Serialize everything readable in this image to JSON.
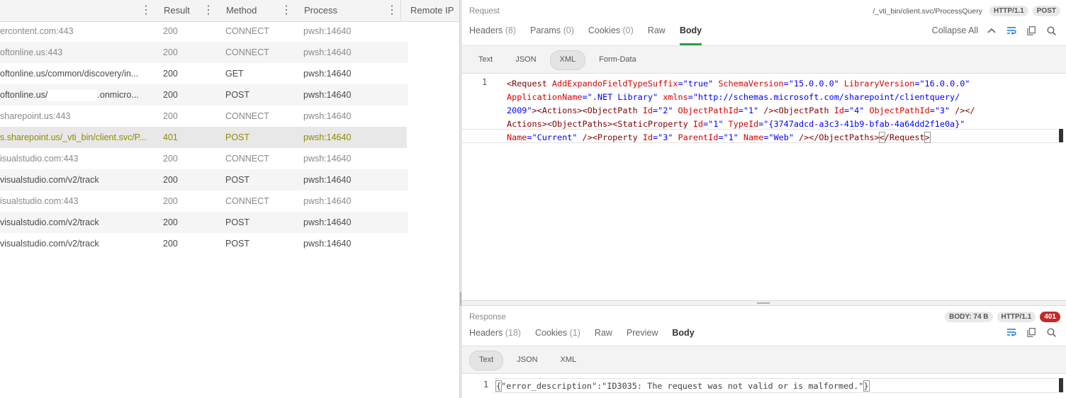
{
  "columns": [
    {
      "label": ""
    },
    {
      "label": "Result"
    },
    {
      "label": "Method"
    },
    {
      "label": "Process"
    },
    {
      "label": "Remote IP"
    }
  ],
  "sessions": [
    {
      "url": "ercontent.com:443",
      "result": "200",
      "method": "CONNECT",
      "process": "pwsh:14640",
      "style": "muted"
    },
    {
      "url": "oftonline.us:443",
      "result": "200",
      "method": "CONNECT",
      "process": "pwsh:14640",
      "style": "muted alt"
    },
    {
      "url": "oftonline.us/common/discovery/in...",
      "result": "200",
      "method": "GET",
      "process": "pwsh:14640",
      "style": ""
    },
    {
      "url_a": "oftonline.us/",
      "url_b": ".onmicro...",
      "result": "200",
      "method": "POST",
      "process": "pwsh:14640",
      "style": "alt"
    },
    {
      "url": "sharepoint.us:443",
      "result": "200",
      "method": "CONNECT",
      "process": "pwsh:14640",
      "style": "muted"
    },
    {
      "url": "s.sharepoint.us/_vti_bin/client.svc/P...",
      "result": "401",
      "method": "POST",
      "process": "pwsh:14640",
      "style": "sel"
    },
    {
      "url": "isualstudio.com:443",
      "result": "200",
      "method": "CONNECT",
      "process": "pwsh:14640",
      "style": "muted"
    },
    {
      "url": "visualstudio.com/v2/track",
      "result": "200",
      "method": "POST",
      "process": "pwsh:14640",
      "style": "alt"
    },
    {
      "url": "isualstudio.com:443",
      "result": "200",
      "method": "CONNECT",
      "process": "pwsh:14640",
      "style": "muted"
    },
    {
      "url": "visualstudio.com/v2/track",
      "result": "200",
      "method": "POST",
      "process": "pwsh:14640",
      "style": "alt"
    },
    {
      "url": "visualstudio.com/v2/track",
      "result": "200",
      "method": "POST",
      "process": "pwsh:14640",
      "style": ""
    }
  ],
  "request": {
    "title": "Request",
    "url": "/_vti_bin/client.svc/ProcessQuery",
    "protocol": "HTTP/1.1",
    "method": "POST",
    "tabs": [
      {
        "label": "Headers",
        "count": "(8)"
      },
      {
        "label": "Params",
        "count": "(0)"
      },
      {
        "label": "Cookies",
        "count": "(0)"
      },
      {
        "label": "Raw",
        "count": ""
      },
      {
        "label": "Body",
        "count": ""
      }
    ],
    "collapse_label": "Collapse All",
    "formats": [
      "Text",
      "JSON",
      "XML",
      "Form-Data"
    ],
    "line_number": "1",
    "body": {
      "l1": {
        "t1": "<Request ",
        "a1": "AddExpandoFieldTypeSuffix",
        "eq1": "=",
        "v1": "\"true\"",
        "a2": " SchemaVersion",
        "eq2": "=",
        "v2": "\"15.0.0.0\"",
        "a3": " LibraryVersion",
        "eq3": "=",
        "v3": "\"16.0.0.0\""
      },
      "l2": {
        "a1": "ApplicationName",
        "eq1": "=",
        "v1": "\".NET Library\"",
        "a2": " xmlns",
        "eq2": "=",
        "v2": "\"http://schemas.microsoft.com/sharepoint/clientquery/"
      },
      "l3": {
        "v1": "2009\"",
        "t1": "><Actions><ObjectPath ",
        "a1": "Id",
        "eq1": "=",
        "v2": "\"2\"",
        "a2": " ObjectPathId",
        "eq2": "=",
        "v3": "\"1\"",
        "t2": " /><ObjectPath ",
        "a3": "Id",
        "eq3": "=",
        "v4": "\"4\"",
        "a4": " ObjectPathId",
        "eq4": "=",
        "v5": "\"3\"",
        "t3": " /></"
      },
      "l4": {
        "t1": "Actions><ObjectPaths><StaticProperty ",
        "a1": "Id",
        "eq1": "=",
        "v1": "\"1\"",
        "a2": " TypeId",
        "eq2": "=",
        "v2": "\"{3747adcd-a3c3-41b9-bfab-4a64dd2f1e0a}\""
      },
      "l5": {
        "a1": "Name",
        "eq1": "=",
        "v1": "\"Current\"",
        "t1": " /><Property ",
        "a2": "Id",
        "eq2": "=",
        "v2": "\"3\"",
        "a3": " ParentId",
        "eq3": "=",
        "v3": "\"1\"",
        "a4": " Name",
        "eq4": "=",
        "v4": "\"Web\"",
        "t2": " /></ObjectPaths>",
        "t3": "<",
        "t4": "/Request",
        "t5": ">"
      }
    }
  },
  "response": {
    "title": "Response",
    "body_size": "BODY: 74 B",
    "protocol": "HTTP/1.1",
    "status": "401",
    "tabs": [
      {
        "label": "Headers",
        "count": "(18)"
      },
      {
        "label": "Cookies",
        "count": "(1)"
      },
      {
        "label": "Raw",
        "count": ""
      },
      {
        "label": "Preview",
        "count": ""
      },
      {
        "label": "Body",
        "count": ""
      }
    ],
    "formats": [
      "Text",
      "JSON",
      "XML"
    ],
    "line_number": "1",
    "body": {
      "open": "{",
      "key": "\"error_description\"",
      "colon": ":",
      "value": "\"ID3035: The request was not valid or is malformed.\"",
      "close": "}"
    }
  },
  "colors": {
    "accent": "#2ea043",
    "error_badge": "#c62828",
    "selected_row_text": "#8c8c00"
  }
}
